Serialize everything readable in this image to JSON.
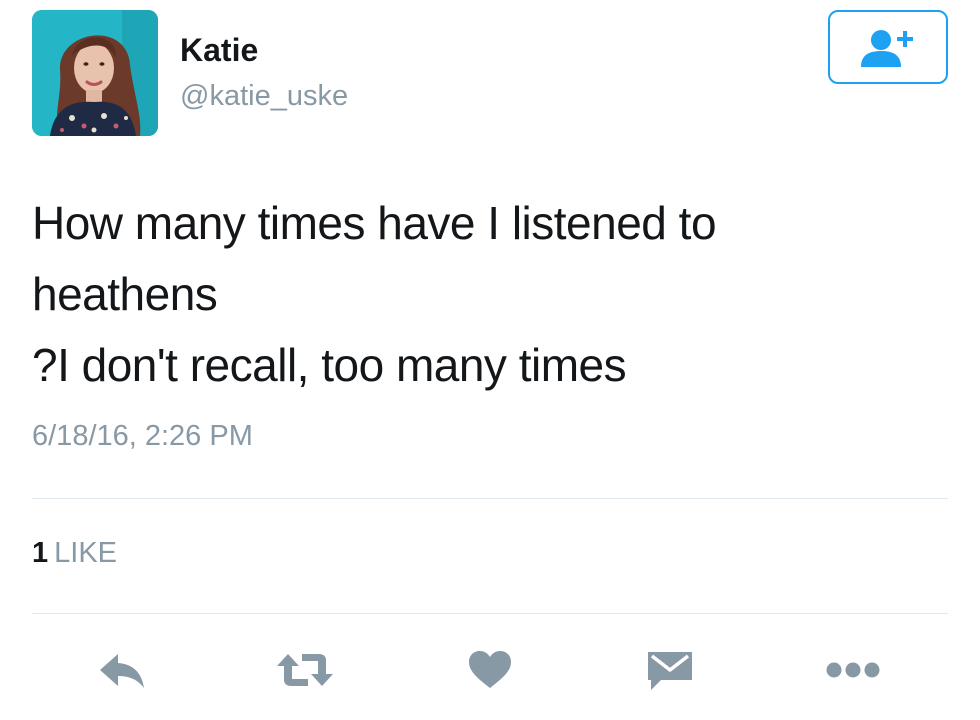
{
  "user": {
    "name": "Katie",
    "handle": "@katie_uske"
  },
  "tweet": {
    "lines": [
      "How many times have I listened to",
      "heathens",
      "?I don't recall, too many times"
    ],
    "timestamp": "6/18/16, 2:26 PM"
  },
  "stats": {
    "like_count": "1",
    "like_label": "LIKE"
  },
  "icons": {
    "follow": "add-user-icon",
    "reply": "reply-icon",
    "retweet": "retweet-icon",
    "like": "heart-icon",
    "dm": "envelope-icon",
    "more": "more-dots-icon"
  },
  "colors": {
    "accent": "#1da1f2",
    "action_gray": "#8899a6",
    "text": "#14171a"
  }
}
